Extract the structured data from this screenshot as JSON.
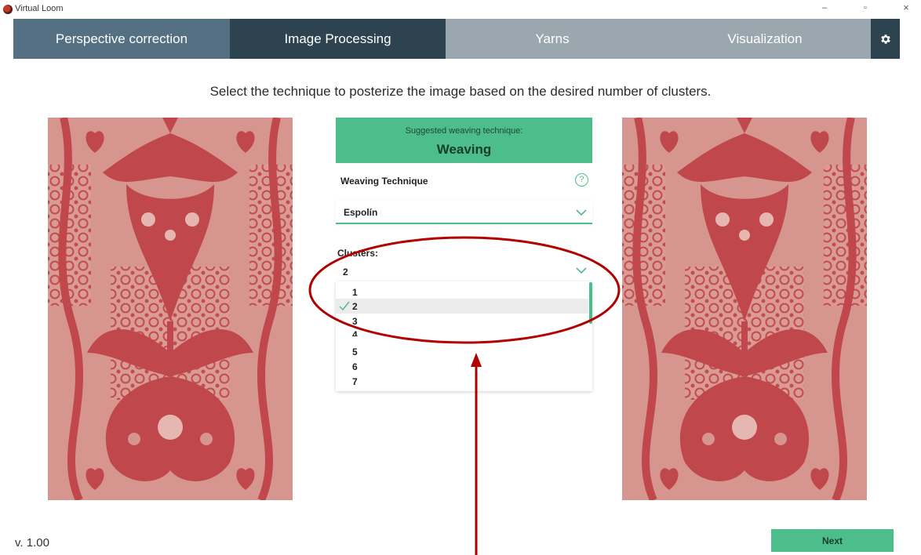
{
  "window": {
    "title": "Virtual Loom",
    "controls": {
      "minimize": "–",
      "maximize": "▫",
      "close": "×"
    }
  },
  "tabs": [
    {
      "label": "Perspective correction",
      "state": "visited"
    },
    {
      "label": "Image Processing",
      "state": "active"
    },
    {
      "label": "Yarns",
      "state": "disabled"
    },
    {
      "label": "Visualization",
      "state": "disabled"
    }
  ],
  "settings_icon": "gear-icon",
  "instruction": "Select the technique to posterize the image based on the desired number of clusters.",
  "suggestion": {
    "label": "Suggested weaving technique:",
    "value": "Weaving"
  },
  "weaving_technique": {
    "label": "Weaving Technique",
    "help_icon": "question-circle-icon",
    "selected": "Espolín"
  },
  "clusters": {
    "label": "Clusters:",
    "selected": "2",
    "options": [
      "1",
      "2",
      "3",
      "4",
      "5",
      "6",
      "7"
    ]
  },
  "footer": {
    "version": "v. 1.00",
    "next_label": "Next"
  },
  "colors": {
    "accent": "#4dbd8b",
    "tab_active": "#2e4350",
    "tab_visited": "#557082",
    "tab_disabled": "#9aa7af",
    "fabric_red": "#c04a4e",
    "fabric_pink": "#d89b94",
    "annotation": "#b00000"
  }
}
